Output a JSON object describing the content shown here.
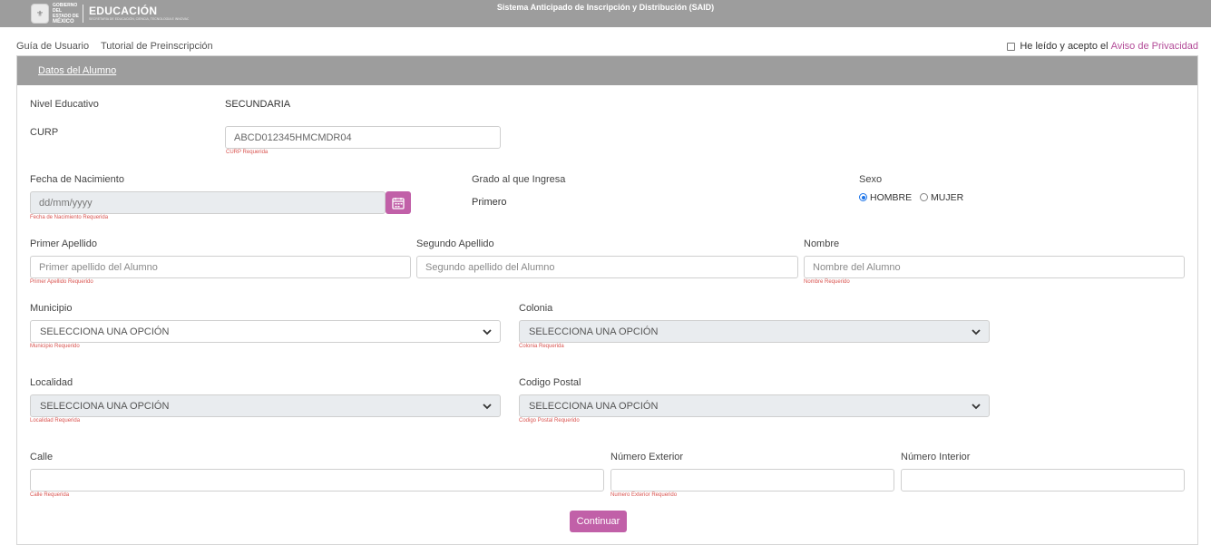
{
  "header": {
    "gobierno_line1": "GOBIERNO DEL",
    "gobierno_line2": "ESTADO DE",
    "gobierno_line3": "MÉXICO",
    "secretaria": "EDUCACIÓN",
    "secretaria_sub": "SECRETARÍA DE EDUCACIÓN, CIENCIA, TECNOLOGÍA E INNOVACIÓN",
    "app_title": "Sistema Anticipado de Inscripción y Distribución (SAID)"
  },
  "nav": {
    "guide": "Guía de Usuario",
    "tutorial": "Tutorial de Preinscripción"
  },
  "privacy": {
    "text": "He leído y acepto el",
    "link": "Aviso de Privacidad"
  },
  "panel": {
    "tab": "Datos del Alumno"
  },
  "form": {
    "nivel_label": "Nivel Educativo",
    "nivel_value": "SECUNDARIA",
    "curp_label": "CURP",
    "curp_value": "ABCD012345HMCMDR04",
    "curp_error": "CURP Requerida",
    "fecha_label": "Fecha de Nacimiento",
    "fecha_placeholder": "dd/mm/yyyy",
    "fecha_error": "Fecha de Nacimiento Requerida",
    "grado_label": "Grado al que Ingresa",
    "grado_value": "Primero",
    "sexo_label": "Sexo",
    "sexo_hombre": "HOMBRE",
    "sexo_mujer": "MUJER",
    "sexo_selected": "HOMBRE",
    "primer_apellido_label": "Primer Apellido",
    "primer_apellido_placeholder": "Primer apellido del Alumno",
    "primer_apellido_error": "Primer Apellido Requerido",
    "segundo_apellido_label": "Segundo Apellido",
    "segundo_apellido_placeholder": "Segundo apellido del Alumno",
    "nombre_label": "Nombre",
    "nombre_placeholder": "Nombre del Alumno",
    "nombre_error": "Nombre Requerido",
    "municipio_label": "Municipio",
    "municipio_value": "SELECCIONA UNA OPCIÓN",
    "municipio_error": "Municipio Requerido",
    "colonia_label": "Colonia",
    "colonia_value": "SELECCIONA UNA OPCIÓN",
    "colonia_error": "Colonia Requerida",
    "localidad_label": "Localidad",
    "localidad_value": "SELECCIONA UNA OPCIÓN",
    "localidad_error": "Localidad Requerida",
    "cp_label": "Codigo Postal",
    "cp_value": "SELECCIONA UNA OPCIÓN",
    "cp_error": "Codigo Postal Requerido",
    "calle_label": "Calle",
    "calle_error": "Calle Requerida",
    "num_ext_label": "Número Exterior",
    "num_ext_error": "Numero Exterior Requerido",
    "num_int_label": "Número Interior",
    "continuar": "Continuar"
  },
  "colors": {
    "header_gray": "#9d9d9d",
    "accent_pink": "#c160a8",
    "error_red": "#d9534f"
  }
}
